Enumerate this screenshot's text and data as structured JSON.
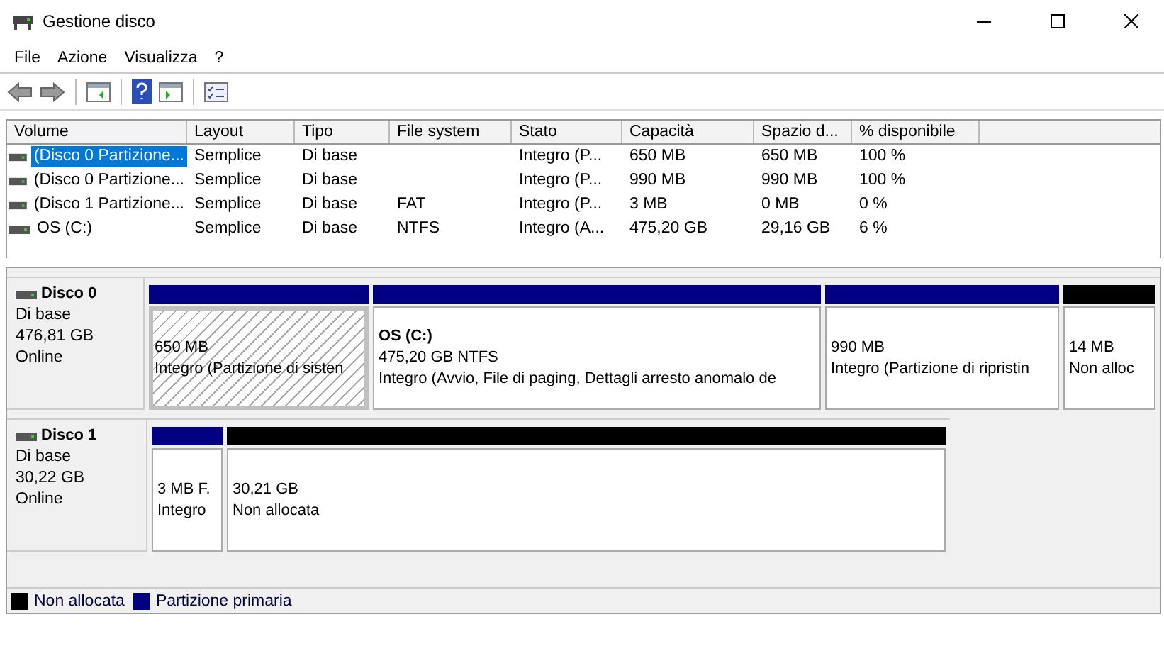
{
  "window": {
    "title": "Gestione disco"
  },
  "menu": [
    "File",
    "Azione",
    "Visualizza",
    "?"
  ],
  "table": {
    "columns": [
      "Volume",
      "Layout",
      "Tipo",
      "File system",
      "Stato",
      "Capacità",
      "Spazio d...",
      "% disponibile"
    ],
    "rows": [
      {
        "selected": true,
        "cells": [
          "(Disco 0 Partizione...",
          "Semplice",
          "Di base",
          "",
          "Integro (P...",
          "650 MB",
          "650 MB",
          "100 %"
        ]
      },
      {
        "selected": false,
        "cells": [
          "(Disco 0 Partizione...",
          "Semplice",
          "Di base",
          "",
          "Integro (P...",
          "990 MB",
          "990 MB",
          "100 %"
        ]
      },
      {
        "selected": false,
        "cells": [
          "(Disco 1 Partizione...",
          "Semplice",
          "Di base",
          "FAT",
          "Integro (P...",
          "3 MB",
          "0 MB",
          "0 %"
        ]
      },
      {
        "selected": false,
        "cells": [
          "OS (C:)",
          "Semplice",
          "Di base",
          "NTFS",
          "Integro (A...",
          "475,20 GB",
          "29,16 GB",
          "6 %"
        ]
      }
    ]
  },
  "disks": [
    {
      "name": "Disco 0",
      "type": "Di base",
      "size": "476,81 GB",
      "status": "Online",
      "partitions": [
        {
          "kind": "primary",
          "selected": true,
          "size": "650 MB",
          "status": "Integro (Partizione di sisten"
        },
        {
          "kind": "primary",
          "selected": false,
          "title": "OS  (C:)",
          "size": "475,20 GB NTFS",
          "status": "Integro (Avvio, File di paging, Dettagli arresto anomalo de"
        },
        {
          "kind": "primary",
          "selected": false,
          "size": "990 MB",
          "status": "Integro (Partizione di ripristin"
        },
        {
          "kind": "unallocated",
          "selected": false,
          "size": "14 MB",
          "status": "Non alloc"
        }
      ]
    },
    {
      "name": "Disco 1",
      "type": "Di base",
      "size": "30,22 GB",
      "status": "Online",
      "partitions": [
        {
          "kind": "primary",
          "selected": false,
          "size": "3 MB F.",
          "status": "Integro"
        },
        {
          "kind": "unallocated",
          "selected": false,
          "size": "30,21 GB",
          "status": "Non allocata"
        }
      ]
    }
  ],
  "legend": [
    {
      "kind": "unallocated",
      "label": "Non allocata"
    },
    {
      "kind": "primary",
      "label": "Partizione primaria"
    }
  ]
}
